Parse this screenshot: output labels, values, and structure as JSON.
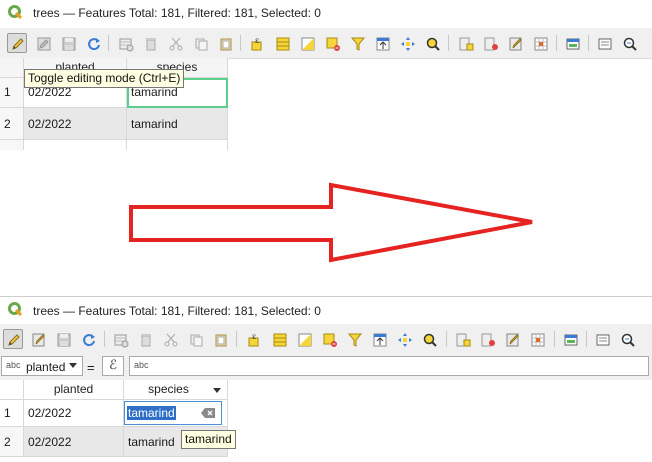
{
  "window": {
    "title": "trees — Features Total: 181, Filtered: 181, Selected: 0"
  },
  "toolbar": {
    "tooltip": "Toggle editing mode (Ctrl+E)",
    "icons": [
      "pencil-icon",
      "multi-edit-icon",
      "save-icon",
      "reload-icon",
      "add-feature-icon",
      "delete-icon",
      "cut-icon",
      "copy-icon",
      "paste-icon",
      "select-expression-icon",
      "select-all-icon",
      "invert-selection-icon",
      "deselect-icon",
      "filter-icon",
      "move-selection-top-icon",
      "pan-to-selected-icon",
      "zoom-to-selected-icon",
      "new-field-icon",
      "delete-field-icon",
      "field-calculator-icon",
      "conditional-format-icon",
      "dock-icon",
      "actions-icon",
      "form-view-icon"
    ]
  },
  "table_before": {
    "columns": [
      "planted",
      "species"
    ],
    "rows": [
      {
        "num": "1",
        "planted": "02/2022",
        "species": "tamarind"
      },
      {
        "num": "2",
        "planted": "02/2022",
        "species": "tamarind"
      }
    ]
  },
  "filter": {
    "field": "planted",
    "operator": "=",
    "expression_symbol": "ℰ",
    "type_tag": "abc"
  },
  "table_after": {
    "columns": [
      "planted",
      "species"
    ],
    "rows": [
      {
        "num": "1",
        "planted": "02/2022",
        "species": "tamarind"
      },
      {
        "num": "2",
        "planted": "02/2022",
        "species": "tamarind"
      }
    ],
    "edit_value": "tamarind",
    "tooltip": "tamarind"
  },
  "colors": {
    "arrow": "#e52320",
    "focus": "#5bd08a",
    "selection": "#2f6fc8"
  }
}
